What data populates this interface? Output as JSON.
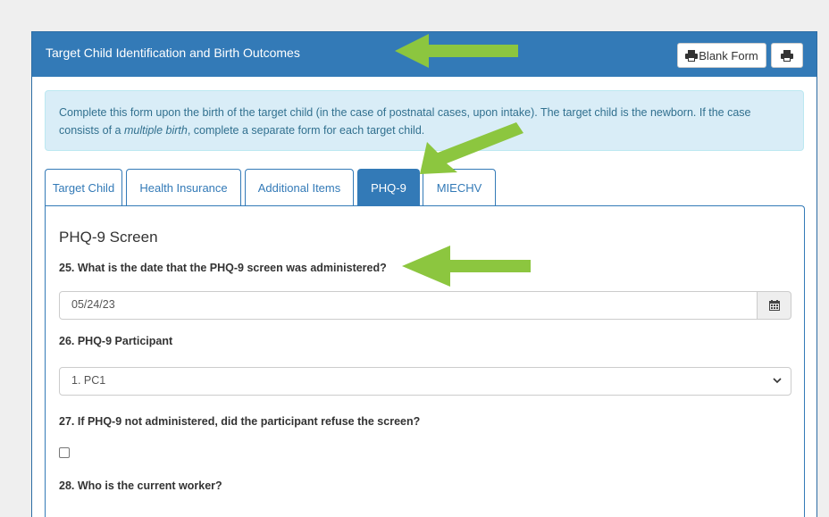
{
  "panel": {
    "title": "Target Child Identification and Birth Outcomes",
    "blank_form_label": "Blank Form"
  },
  "info": {
    "text_before": "Complete this form upon the birth of the target child (in the case of postnatal cases, upon intake). The target child is the newborn. If the case consists of a ",
    "text_emphasis": "multiple birth",
    "text_after": ", complete a separate form for each target child."
  },
  "tabs": [
    {
      "label": "Target Child",
      "active": false
    },
    {
      "label": "Health Insurance",
      "active": false
    },
    {
      "label": "Additional Items",
      "active": false
    },
    {
      "label": "PHQ-9",
      "active": true
    },
    {
      "label": "MIECHV",
      "active": false
    }
  ],
  "form": {
    "section_title": "PHQ-9 Screen",
    "q25_label": "25. What is the date that the PHQ-9 screen was administered?",
    "q25_value": "05/24/23",
    "q26_label": "26. PHQ-9 Participant",
    "q26_value": "1. PC1",
    "q27_label": "27. If PHQ-9 not administered, did the participant refuse the screen?",
    "q27_checked": false,
    "q28_label": "28. Who is the current worker?"
  },
  "colors": {
    "primary": "#337ab7",
    "arrow": "#8cc63f",
    "info_bg": "#d9edf7"
  },
  "icons": [
    "print-icon",
    "calendar-icon",
    "chevron-down-icon",
    "arrow-left-icon"
  ]
}
